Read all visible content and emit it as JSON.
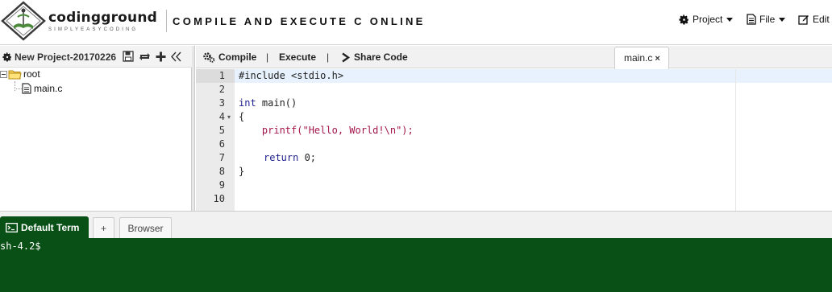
{
  "header": {
    "brand_name": "codingground",
    "brand_tagline": "SIMPLYEASYCODING",
    "page_heading": "COMPILE AND EXECUTE C ONLINE",
    "menus": [
      {
        "label": "Project",
        "icon": "gear-icon"
      },
      {
        "label": "File",
        "icon": "file-icon"
      },
      {
        "label": "Edit",
        "icon": "edit-icon"
      }
    ]
  },
  "project": {
    "title": "New Project-20170226",
    "tools": [
      "save-icon",
      "refresh-icon",
      "plus-icon",
      "collapse-icon"
    ],
    "tree": {
      "root_label": "root",
      "files": [
        "main.c"
      ]
    }
  },
  "toolbar": {
    "compile_label": "Compile",
    "execute_label": "Execute",
    "share_label": "Share Code",
    "separator": "|",
    "active_file_tab": "main.c",
    "close_glyph": "×"
  },
  "editor": {
    "line_numbers": [
      "1",
      "2",
      "3",
      "4",
      "5",
      "6",
      "7",
      "8",
      "9",
      "10"
    ],
    "fold_marker": "▾",
    "lines": [
      {
        "kw": "",
        "text": "#include <stdio.h>"
      },
      {
        "kw": "",
        "text": ""
      },
      {
        "kw": "int",
        "text": " main()"
      },
      {
        "kw": "",
        "text": "{"
      },
      {
        "kw": "",
        "text": "    printf(\"Hello, World!\\n\");"
      },
      {
        "kw": "",
        "text": ""
      },
      {
        "kw": "return",
        "text": " 0;"
      },
      {
        "kw": "",
        "text": "}"
      },
      {
        "kw": "",
        "text": ""
      },
      {
        "kw": "",
        "text": ""
      }
    ]
  },
  "terminal": {
    "active_tab": "Default Term",
    "add_tab": "+",
    "browser_tab": "Browser",
    "prompt": "sh-4.2$",
    "background": "#085016"
  }
}
